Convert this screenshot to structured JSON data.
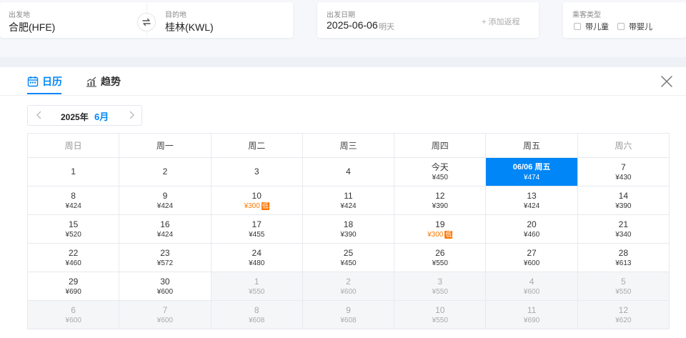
{
  "search": {
    "from_label": "出发地",
    "from_value": "合肥(HFE)",
    "to_label": "目的地",
    "to_value": "桂林(KWL)",
    "date_label": "出发日期",
    "date_value": "2025-06-06",
    "date_sub": "明天",
    "add_return": "+ 添加返程",
    "pax_label": "乘客类型",
    "child_label": "带儿童",
    "infant_label": "带婴儿"
  },
  "tabs": {
    "calendar": "日历",
    "trend": "趋势"
  },
  "month_nav": {
    "year": "2025年",
    "month": "6月"
  },
  "weekdays": [
    "周日",
    "周一",
    "周二",
    "周三",
    "周四",
    "周五",
    "周六"
  ],
  "low_badge": "低",
  "calendar": [
    [
      {
        "day": "1",
        "price": ""
      },
      {
        "day": "2",
        "price": ""
      },
      {
        "day": "3",
        "price": ""
      },
      {
        "day": "4",
        "price": ""
      },
      {
        "day": "今天",
        "price": "¥450"
      },
      {
        "day": "06/06 周五",
        "price": "¥474",
        "state": "sel"
      },
      {
        "day": "7",
        "price": "¥430"
      }
    ],
    [
      {
        "day": "8",
        "price": "¥424"
      },
      {
        "day": "9",
        "price": "¥424"
      },
      {
        "day": "10",
        "price": "¥300",
        "state": "low"
      },
      {
        "day": "11",
        "price": "¥424"
      },
      {
        "day": "12",
        "price": "¥390"
      },
      {
        "day": "13",
        "price": "¥424"
      },
      {
        "day": "14",
        "price": "¥390"
      }
    ],
    [
      {
        "day": "15",
        "price": "¥520"
      },
      {
        "day": "16",
        "price": "¥424"
      },
      {
        "day": "17",
        "price": "¥455"
      },
      {
        "day": "18",
        "price": "¥390"
      },
      {
        "day": "19",
        "price": "¥300",
        "state": "low"
      },
      {
        "day": "20",
        "price": "¥460"
      },
      {
        "day": "21",
        "price": "¥340"
      }
    ],
    [
      {
        "day": "22",
        "price": "¥460"
      },
      {
        "day": "23",
        "price": "¥572"
      },
      {
        "day": "24",
        "price": "¥480"
      },
      {
        "day": "25",
        "price": "¥450"
      },
      {
        "day": "26",
        "price": "¥550"
      },
      {
        "day": "27",
        "price": "¥600"
      },
      {
        "day": "28",
        "price": "¥613"
      }
    ],
    [
      {
        "day": "29",
        "price": "¥690"
      },
      {
        "day": "30",
        "price": "¥600"
      },
      {
        "day": "1",
        "price": "¥550",
        "state": "muted"
      },
      {
        "day": "2",
        "price": "¥600",
        "state": "muted"
      },
      {
        "day": "3",
        "price": "¥550",
        "state": "muted"
      },
      {
        "day": "4",
        "price": "¥600",
        "state": "muted"
      },
      {
        "day": "5",
        "price": "¥550",
        "state": "muted"
      }
    ],
    [
      {
        "day": "6",
        "price": "¥600",
        "state": "muted"
      },
      {
        "day": "7",
        "price": "¥600",
        "state": "muted"
      },
      {
        "day": "8",
        "price": "¥608",
        "state": "muted"
      },
      {
        "day": "9",
        "price": "¥608",
        "state": "muted"
      },
      {
        "day": "10",
        "price": "¥550",
        "state": "muted"
      },
      {
        "day": "11",
        "price": "¥690",
        "state": "muted"
      },
      {
        "day": "12",
        "price": "¥620",
        "state": "muted"
      }
    ]
  ]
}
